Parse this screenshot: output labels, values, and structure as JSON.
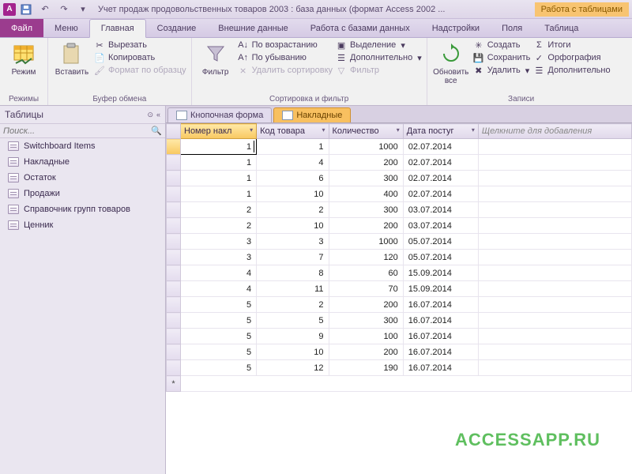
{
  "title": "Учет продаж продовольственных товаров 2003 : база данных (формат Access 2002 ...",
  "context_tab": "Работа с таблицами",
  "menu": {
    "file": "Файл",
    "tabs": [
      "Меню",
      "Главная",
      "Создание",
      "Внешние данные",
      "Работа с базами данных",
      "Надстройки",
      "Поля",
      "Таблица"
    ],
    "active": "Главная"
  },
  "ribbon": {
    "modes": {
      "label": "Режимы",
      "btn": "Режим"
    },
    "clipboard": {
      "label": "Буфер обмена",
      "paste": "Вставить",
      "cut": "Вырезать",
      "copy": "Копировать",
      "format": "Формат по образцу"
    },
    "sortfilter": {
      "label": "Сортировка и фильтр",
      "filter": "Фильтр",
      "asc": "По возрастанию",
      "desc": "По убыванию",
      "clear": "Удалить сортировку",
      "selection": "Выделение",
      "advanced": "Дополнительно",
      "toggle": "Фильтр"
    },
    "records": {
      "label": "Записи",
      "refresh": "Обновить все",
      "new": "Создать",
      "save": "Сохранить",
      "delete": "Удалить",
      "totals": "Итоги",
      "spell": "Орфография",
      "more": "Дополнительно"
    }
  },
  "nav": {
    "header": "Таблицы",
    "search_ph": "Поиск...",
    "items": [
      "Switchboard Items",
      "Накладные",
      "Остаток",
      "Продажи",
      "Справочник групп товаров",
      "Ценник"
    ]
  },
  "doc_tabs": [
    {
      "label": "Кнопочная форма",
      "active": false
    },
    {
      "label": "Накладные",
      "active": true
    }
  ],
  "grid": {
    "columns": [
      "Номер накл",
      "Код товара",
      "Количество",
      "Дата постуг"
    ],
    "add_col": "Щелкните для добавления",
    "rows": [
      [
        "1",
        "1",
        "1000",
        "02.07.2014"
      ],
      [
        "1",
        "4",
        "200",
        "02.07.2014"
      ],
      [
        "1",
        "6",
        "300",
        "02.07.2014"
      ],
      [
        "1",
        "10",
        "400",
        "02.07.2014"
      ],
      [
        "2",
        "2",
        "300",
        "03.07.2014"
      ],
      [
        "2",
        "10",
        "200",
        "03.07.2014"
      ],
      [
        "3",
        "3",
        "1000",
        "05.07.2014"
      ],
      [
        "3",
        "7",
        "120",
        "05.07.2014"
      ],
      [
        "4",
        "8",
        "60",
        "15.09.2014"
      ],
      [
        "4",
        "11",
        "70",
        "15.09.2014"
      ],
      [
        "5",
        "2",
        "200",
        "16.07.2014"
      ],
      [
        "5",
        "5",
        "300",
        "16.07.2014"
      ],
      [
        "5",
        "9",
        "100",
        "16.07.2014"
      ],
      [
        "5",
        "10",
        "200",
        "16.07.2014"
      ],
      [
        "5",
        "12",
        "190",
        "16.07.2014"
      ]
    ]
  },
  "watermark": "ACCESSAPP.RU"
}
